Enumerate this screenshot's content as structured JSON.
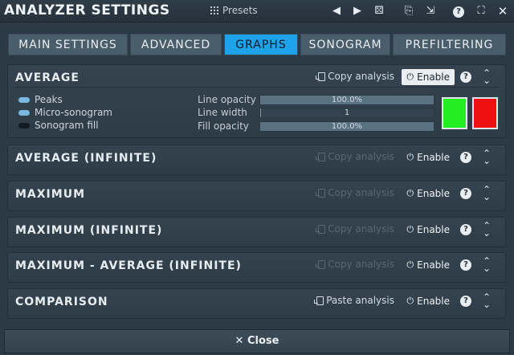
{
  "window": {
    "title": "ANALYZER SETTINGS",
    "presets_label": "Presets",
    "icons": [
      "prev-arrow-icon",
      "next-arrow-icon",
      "randomize-icon",
      "copy-icon",
      "paste-icon",
      "help-icon",
      "fullscreen-icon",
      "close-icon"
    ]
  },
  "tabs": [
    {
      "label": "MAIN SETTINGS",
      "active": false
    },
    {
      "label": "ADVANCED",
      "active": false
    },
    {
      "label": "GRAPHS",
      "active": true
    },
    {
      "label": "SONOGRAM",
      "active": false
    },
    {
      "label": "PREFILTERING",
      "active": false
    }
  ],
  "panels": [
    {
      "title": "AVERAGE",
      "action": "Copy analysis",
      "enable": "Enable",
      "enabled": true,
      "expanded": true,
      "options": [
        {
          "label": "Peaks",
          "on": true
        },
        {
          "label": "Micro-sonogram",
          "on": true
        },
        {
          "label": "Sonogram fill",
          "on": false
        }
      ],
      "sliders": [
        {
          "label": "Line opacity",
          "value": "100.0%",
          "fraction": 1.0
        },
        {
          "label": "Line width",
          "value": "1",
          "fraction": 0.0
        },
        {
          "label": "Fill opacity",
          "value": "100.0%",
          "fraction": 1.0
        }
      ],
      "colors": {
        "line": "#22ee22",
        "fill": "#ee1111"
      }
    },
    {
      "title": "AVERAGE (INFINITE)",
      "action": "Copy analysis",
      "enable": "Enable",
      "enabled": false
    },
    {
      "title": "MAXIMUM",
      "action": "Copy analysis",
      "enable": "Enable",
      "enabled": false
    },
    {
      "title": "MAXIMUM (INFINITE)",
      "action": "Copy analysis",
      "enable": "Enable",
      "enabled": false
    },
    {
      "title": "MAXIMUM - AVERAGE (INFINITE)",
      "action": "Copy analysis",
      "enable": "Enable",
      "enabled": false
    },
    {
      "title": "COMPARISON",
      "action": "Paste analysis",
      "enable": "Enable",
      "enabled": false
    }
  ],
  "help_glyph": "?",
  "close_label": "Close",
  "accent_color": "#1ea2ea"
}
